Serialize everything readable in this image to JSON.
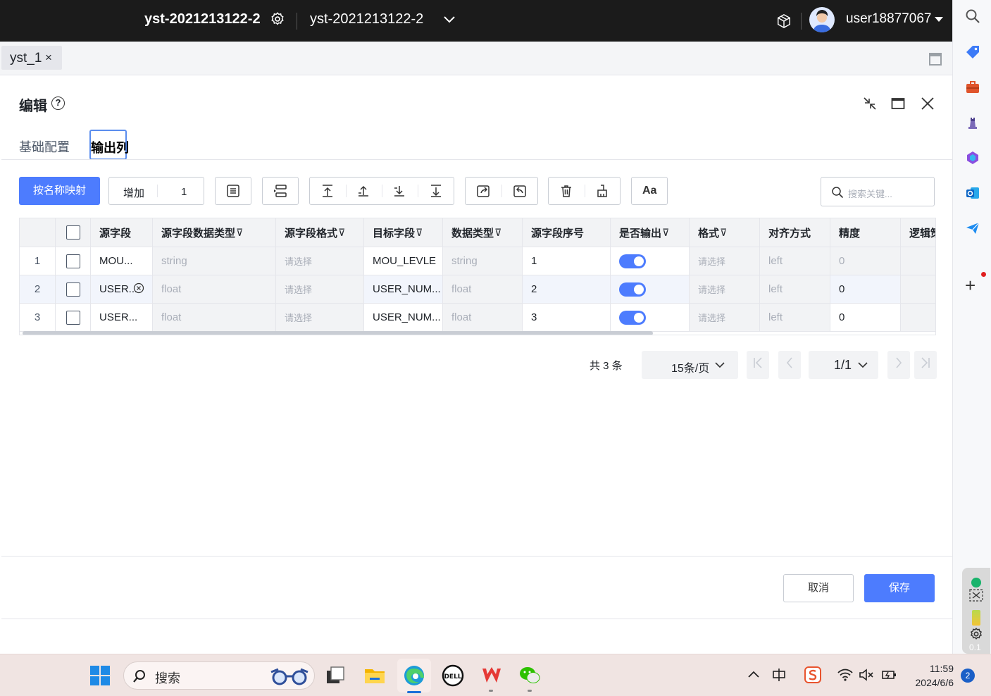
{
  "topbar": {
    "workspace_name": "yst-2021213122-2",
    "workspace_selector": "yst-2021213122-2",
    "username": "user18877067"
  },
  "tabstrip": {
    "tab_label": "yst_1",
    "tab_close": "×"
  },
  "dialog": {
    "title": "编辑",
    "help": "?",
    "tabs": [
      "基础配置",
      "输出列"
    ],
    "active_tab": "输出列",
    "toolbar": {
      "map_by_name": "按名称映射",
      "add_label": "增加",
      "add_count": "1",
      "format_label": "Aa",
      "search_placeholder": "搜索关键..."
    },
    "table": {
      "columns": [
        "源字段",
        "源字段数据类型",
        "源字段格式",
        "目标字段",
        "数据类型",
        "源字段序号",
        "是否输出",
        "格式",
        "对齐方式",
        "精度",
        "逻辑策"
      ],
      "filterable": [
        false,
        true,
        true,
        true,
        true,
        false,
        true,
        true,
        false,
        false,
        false
      ],
      "filter_glyph": "⊽",
      "rows": [
        {
          "no": "1",
          "source": "MOU...",
          "source_type": "string",
          "source_format": "请选择",
          "target": "MOU_LEVLE",
          "type": "string",
          "seq": "1",
          "output": true,
          "format": "请选择",
          "align": "left",
          "precision": "0"
        },
        {
          "no": "2",
          "source": "USER...",
          "source_type": "float",
          "source_format": "请选择",
          "target": "USER_NUM...",
          "type": "float",
          "seq": "2",
          "output": true,
          "format": "请选择",
          "align": "left",
          "precision": "0"
        },
        {
          "no": "3",
          "source": "USER...",
          "source_type": "float",
          "source_format": "请选择",
          "target": "USER_NUM...",
          "type": "float",
          "seq": "3",
          "output": true,
          "format": "请选择",
          "align": "left",
          "precision": "0"
        }
      ]
    },
    "pagination": {
      "total": "共 3 条",
      "page_size": "15条/页",
      "page": "1/1"
    },
    "footer": {
      "cancel": "取消",
      "save": "保存"
    }
  },
  "widget": {
    "value": "0.1"
  },
  "taskbar": {
    "search": "搜索",
    "time": "11:59",
    "date": "2024/6/6",
    "notifications": "2"
  },
  "colors": {
    "primary": "#4d7cfe",
    "topbar": "#1b1b1b"
  }
}
